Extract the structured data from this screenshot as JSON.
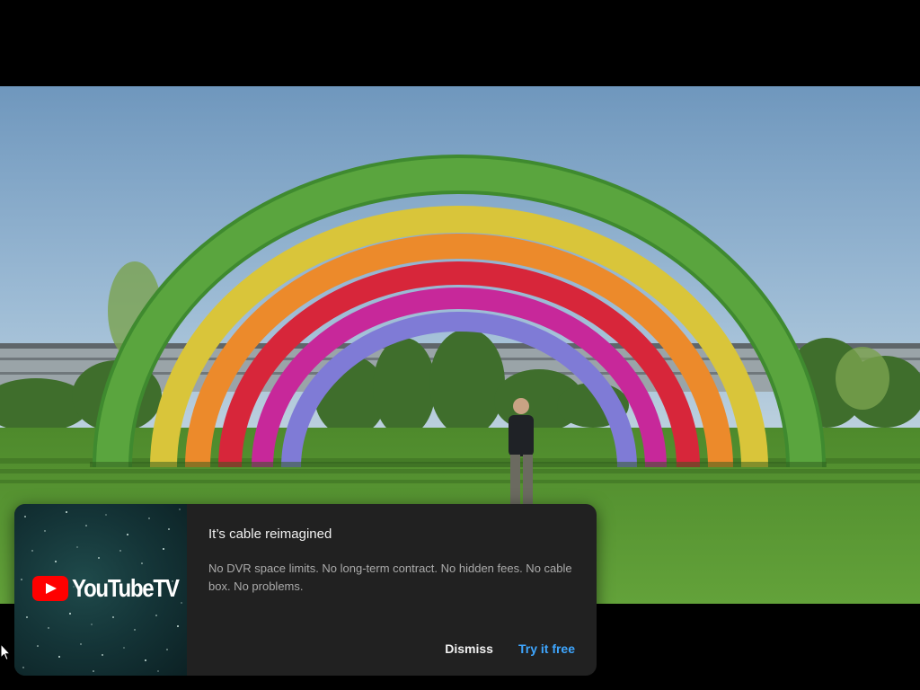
{
  "promo": {
    "brand_logo_text": "YouTubeTV",
    "title": "It’s cable reimagined",
    "body": "No DVR space limits. No long-term contract. No hidden fees. No cable box. No problems.",
    "dismiss_label": "Dismiss",
    "cta_label": "Try it free"
  },
  "icons": {
    "brand": "youtube-play-icon",
    "cursor": "mouse-pointer-icon"
  },
  "colors": {
    "background": "#000000",
    "card": "#212121",
    "cta": "#3ea6ff",
    "brand_red": "#ff0000"
  }
}
